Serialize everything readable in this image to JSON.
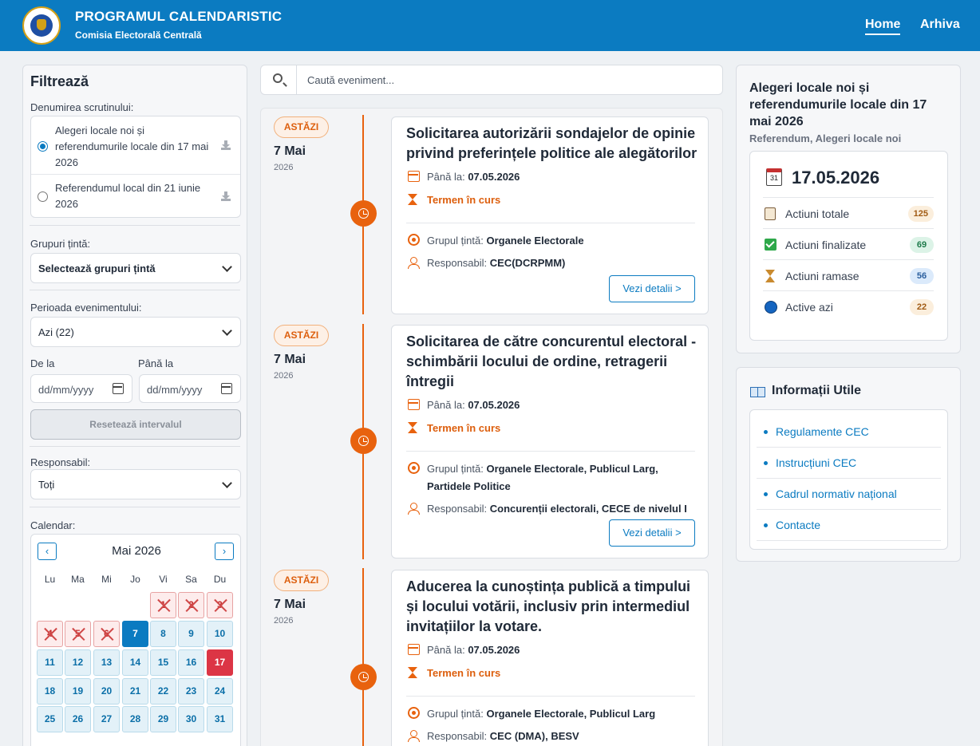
{
  "header": {
    "title": "PROGRAMUL CALENDARISTIC",
    "subtitle": "Comisia Electorală Centrală",
    "nav": [
      {
        "label": "Home",
        "active": true
      },
      {
        "label": "Arhiva",
        "active": false
      }
    ]
  },
  "filter": {
    "title": "Filtrează",
    "scrutin_label": "Denumirea scrutinului:",
    "scrutins": [
      {
        "label": "Alegeri locale noi și referendumurile locale din 17 mai 2026",
        "selected": true
      },
      {
        "label": "Referendumul local din 21 iunie 2026",
        "selected": false
      }
    ],
    "grupuri_label": "Grupuri țintă:",
    "grupuri_value": "Selectează grupuri țintă",
    "perioada_label": "Perioada evenimentului:",
    "perioada_value": "Azi (22)",
    "de_la_label": "De la",
    "pana_la_label": "Până la",
    "date_placeholder": "dd/mm/yyyy",
    "reset_label": "Resetează intervalul",
    "responsabil_label": "Responsabil:",
    "responsabil_value": "Toți",
    "calendar_label": "Calendar:"
  },
  "calendar": {
    "month": "Mai 2026",
    "prev": "‹",
    "next": "›",
    "weekdays": [
      "Lu",
      "Ma",
      "Mi",
      "Jo",
      "Vi",
      "Sa",
      "Du"
    ],
    "first_weekday_index": 4,
    "days_in_month": 31,
    "past_days": [
      1,
      2,
      3,
      4,
      5,
      6
    ],
    "today": 7,
    "highlight": 17
  },
  "search": {
    "placeholder": "Caută eveniment..."
  },
  "events": [
    {
      "badge": "ASTĂZI",
      "day": "7 Mai",
      "year": "2026",
      "title": "Solicitarea autorizării sondajelor de opinie privind preferințele politice ale alegătorilor",
      "pana_la_label": "Până la:",
      "pana_la": "07.05.2026",
      "status": "Termen în curs",
      "grup_label": "Grupul țintă:",
      "grup": "Organele Electorale",
      "resp_label": "Responsabil:",
      "resp": "CEC(DCRPMM)",
      "button": "Vezi detalii >"
    },
    {
      "badge": "ASTĂZI",
      "day": "7 Mai",
      "year": "2026",
      "title": "Solicitarea de către concurentul electoral - schimbării locului de ordine, retragerii întregii",
      "pana_la_label": "Până la:",
      "pana_la": "07.05.2026",
      "status": "Termen în curs",
      "grup_label": "Grupul țintă:",
      "grup": "Organele Electorale, Publicul Larg, Partidele Politice",
      "resp_label": "Responsabil:",
      "resp": "Concurenții electorali, CECE de nivelul I",
      "button": "Vezi detalii >"
    },
    {
      "badge": "ASTĂZI",
      "day": "7 Mai",
      "year": "2026",
      "title": "Aducerea la cunoștința publică a timpului și locului votării, inclusiv prin intermediul invitațiilor la votare.",
      "pana_la_label": "Până la:",
      "pana_la": "07.05.2026",
      "status": "Termen în curs",
      "grup_label": "Grupul țintă:",
      "grup": "Organele Electorale, Publicul Larg",
      "resp_label": "Responsabil:",
      "resp": "CEC (DMA), BESV",
      "button": ""
    }
  ],
  "summary": {
    "title": "Alegeri locale noi și referendumurile locale din 17 mai 2026",
    "subtitle": "Referendum, Alegeri locale noi",
    "date_icon_text": "31",
    "date": "17.05.2026",
    "stats": [
      {
        "icon": "clipboard-icon",
        "label": "Actiuni totale",
        "value": "125",
        "color": "#fbeedc"
      },
      {
        "icon": "check-icon",
        "label": "Actiuni finalizate",
        "value": "69",
        "color": "#dcf3e7"
      },
      {
        "icon": "hourglass-icon",
        "label": "Actiuni ramase",
        "value": "56",
        "color": "#dbeafb"
      },
      {
        "icon": "blue-circle-icon",
        "label": "Active azi",
        "value": "22",
        "color": "#fbeedc"
      }
    ]
  },
  "info": {
    "title": "Informații Utile",
    "links": [
      "Regulamente CEC",
      "Instrucțiuni CEC",
      "Cadrul normativ național",
      "Contacte"
    ]
  }
}
